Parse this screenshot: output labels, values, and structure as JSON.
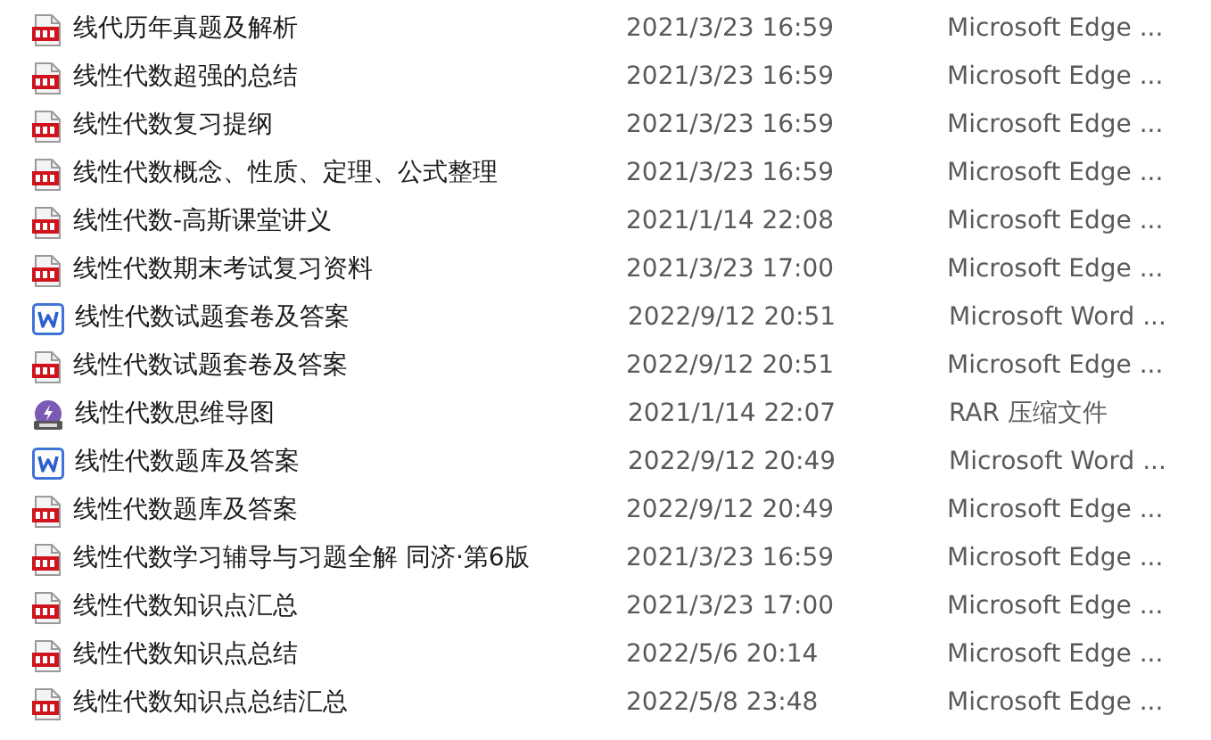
{
  "files": [
    {
      "kind": "pdf",
      "name": "线代历年真题及解析",
      "modified": "2021/3/23 16:59",
      "type": "Microsoft Edge ..."
    },
    {
      "kind": "pdf",
      "name": "线性代数超强的总结",
      "modified": "2021/3/23 16:59",
      "type": "Microsoft Edge ..."
    },
    {
      "kind": "pdf",
      "name": "线性代数复习提纲",
      "modified": "2021/3/23 16:59",
      "type": "Microsoft Edge ..."
    },
    {
      "kind": "pdf",
      "name": "线性代数概念、性质、定理、公式整理",
      "modified": "2021/3/23 16:59",
      "type": "Microsoft Edge ..."
    },
    {
      "kind": "pdf",
      "name": "线性代数-高斯课堂讲义",
      "modified": "2021/1/14 22:08",
      "type": "Microsoft Edge ..."
    },
    {
      "kind": "pdf",
      "name": "线性代数期末考试复习资料",
      "modified": "2021/3/23 17:00",
      "type": "Microsoft Edge ..."
    },
    {
      "kind": "word",
      "name": "线性代数试题套卷及答案",
      "modified": "2022/9/12 20:51",
      "type": "Microsoft Word ..."
    },
    {
      "kind": "pdf",
      "name": "线性代数试题套卷及答案",
      "modified": "2022/9/12 20:51",
      "type": "Microsoft Edge ..."
    },
    {
      "kind": "rar",
      "name": "线性代数思维导图",
      "modified": "2021/1/14 22:07",
      "type": "RAR 压缩文件"
    },
    {
      "kind": "word",
      "name": "线性代数题库及答案",
      "modified": "2022/9/12 20:49",
      "type": "Microsoft Word ..."
    },
    {
      "kind": "pdf",
      "name": "线性代数题库及答案",
      "modified": "2022/9/12 20:49",
      "type": "Microsoft Edge ..."
    },
    {
      "kind": "pdf",
      "name": "线性代数学习辅导与习题全解  同济·第6版",
      "modified": "2021/3/23 16:59",
      "type": "Microsoft Edge ..."
    },
    {
      "kind": "pdf",
      "name": "线性代数知识点汇总",
      "modified": "2021/3/23 17:00",
      "type": "Microsoft Edge ..."
    },
    {
      "kind": "pdf",
      "name": "线性代数知识点总结",
      "modified": "2022/5/6 20:14",
      "type": "Microsoft Edge ..."
    },
    {
      "kind": "pdf",
      "name": "线性代数知识点总结汇总",
      "modified": "2022/5/8 23:48",
      "type": "Microsoft Edge ..."
    }
  ]
}
